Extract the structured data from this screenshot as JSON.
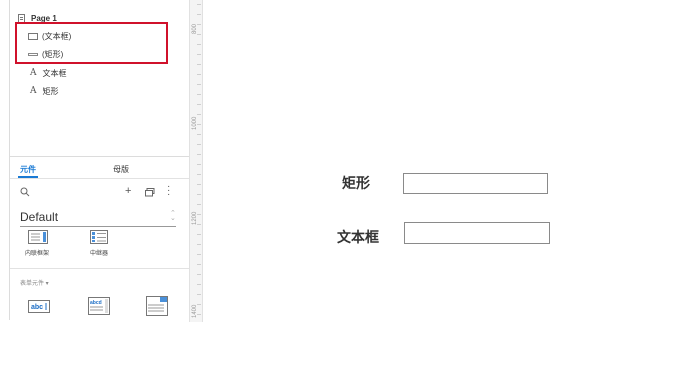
{
  "outline": {
    "page": "Page 1",
    "items": [
      {
        "label": "(文本框)",
        "icon": "textbox-icon"
      },
      {
        "label": "(矩形)",
        "icon": "rectangle-icon"
      },
      {
        "label": "文本框",
        "icon": "text-a-icon"
      },
      {
        "label": "矩形",
        "icon": "text-a-icon"
      }
    ]
  },
  "library": {
    "tabs": [
      "元件",
      "母版"
    ],
    "active_tab": "元件",
    "selected_library": "Default",
    "widgets": [
      "内联框架",
      "中继器"
    ],
    "section": "表单元件 ▾",
    "form_widgets": [
      "text-field-icon",
      "text-area-icon",
      "droplist-icon"
    ]
  },
  "ruler": {
    "labels": [
      "800",
      "1000",
      "1200",
      "1400"
    ]
  },
  "canvas": {
    "labels": [
      "矩形",
      "文本框"
    ]
  },
  "colors": {
    "accent": "#1a7ad4",
    "highlight": "#d0112b"
  }
}
